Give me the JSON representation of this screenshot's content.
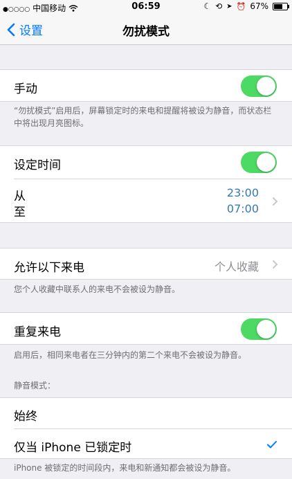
{
  "status_bar": {
    "signal_dots": "●○○○○",
    "carrier": "中国移动",
    "wifi_icon": "wifi-icon",
    "time": "06:59",
    "icons": [
      "moon-icon",
      "lock-rotation-icon",
      "location-icon",
      "alarm-icon"
    ],
    "battery": "67%",
    "battery_level": 0.67
  },
  "nav": {
    "back_label": "设置",
    "title": "勿扰模式"
  },
  "manual": {
    "label": "手动",
    "enabled": true,
    "note": "“勿扰模式”启用后，屏幕锁定时的来电和提醒将被设为静音，而状态栏中将出现月亮图标。"
  },
  "scheduled": {
    "label": "设定时间",
    "enabled": true,
    "from_label": "从",
    "to_label": "至",
    "from_time": "23:00",
    "to_time": "07:00"
  },
  "allow_calls": {
    "label": "允许以下来电",
    "value": "个人收藏",
    "note": "您个人收藏中联系人的来电不会被设为静音。"
  },
  "repeated_calls": {
    "label": "重复来电",
    "enabled": true,
    "note": "启用后，相同来电者在三分钟内的第二个来电不会被设为静音。"
  },
  "silence": {
    "header": "静音模式：",
    "options": [
      "始终",
      "仅当 iPhone 已锁定时"
    ],
    "selected_index": 1,
    "note": "iPhone 被锁定的时间段内，来电和新通知都会被设为静音。"
  },
  "colors": {
    "accent": "#007aff",
    "toggle_on": "#4cd964",
    "time_value": "#3478b9",
    "background": "#efeff4"
  }
}
